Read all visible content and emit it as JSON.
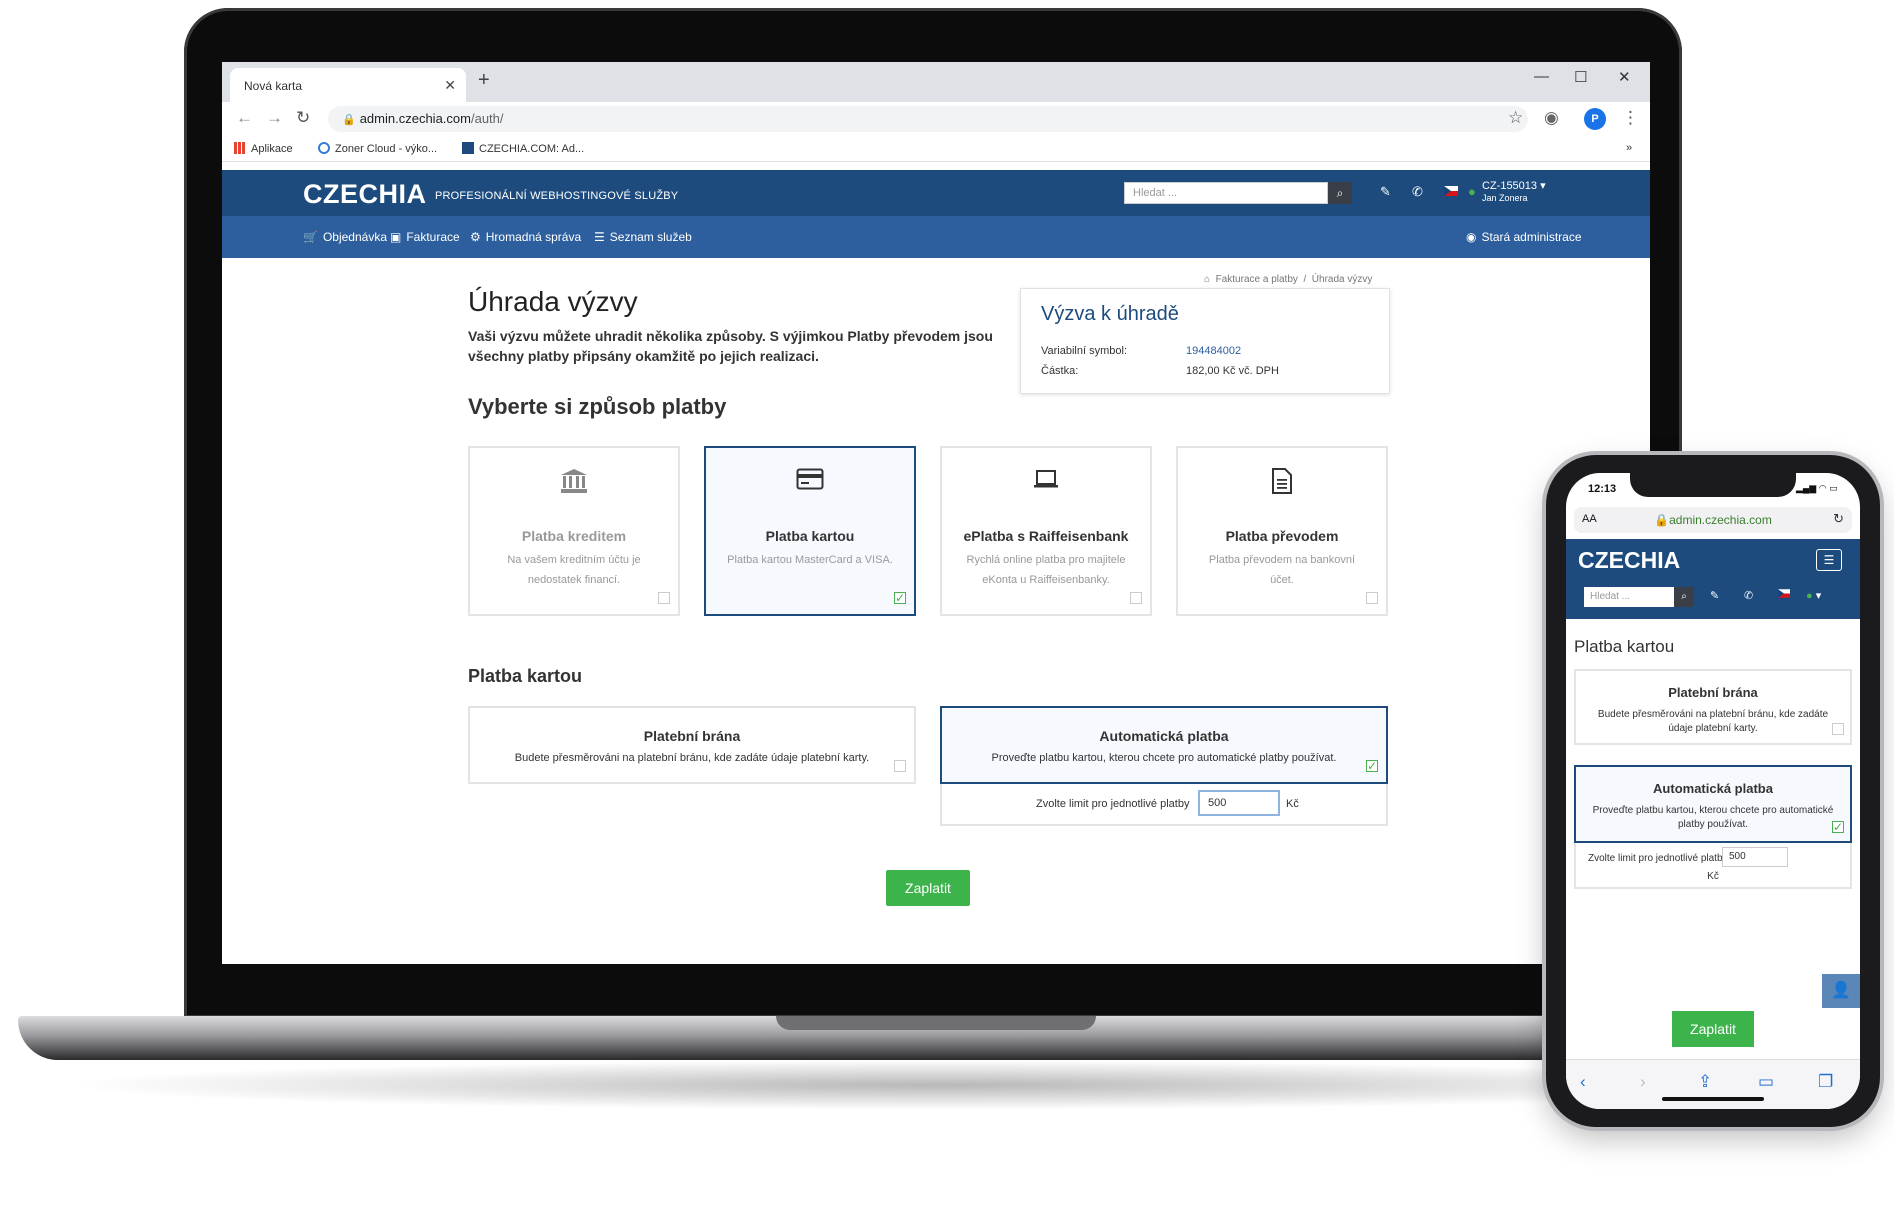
{
  "browser": {
    "tab_title": "Nová karta",
    "url_host": "admin.czechia.com",
    "url_path": "/auth/",
    "profile_initial": "P",
    "bookmarks": [
      "Aplikace",
      "Zoner Cloud - výko...",
      "CZECHIA.COM: Ad..."
    ]
  },
  "site": {
    "logo": "CZECHIA",
    "tagline": "PROFESIONÁLNÍ WEBHOSTINGOVÉ SLUŽBY",
    "search_placeholder": "Hledat ...",
    "account_id": "CZ-155013",
    "account_name": "Jan Zonera",
    "nav": [
      "Objednávka",
      "Fakturace",
      "Hromadná správa",
      "Seznam služeb"
    ],
    "old_admin": "Stará administrace"
  },
  "page": {
    "breadcrumb_1": "Fakturace a platby",
    "breadcrumb_sep": "/",
    "breadcrumb_2": "Úhrada výzvy",
    "title": "Úhrada výzvy",
    "intro": "Vaši výzvu můžete uhradit několika způsoby. S výjimkou Platby převodem jsou všechny platby připsány okamžitě po jejich realizaci.",
    "summary": {
      "title": "Výzva k úhradě",
      "vs_label": "Variabilní symbol:",
      "vs_value": "194484002",
      "amount_label": "Částka:",
      "amount_value": "182,00 Kč vč. DPH"
    },
    "choose_method": "Vyberte si způsob platby",
    "methods": [
      {
        "title": "Platba kreditem",
        "desc": "Na vašem kreditním účtu je nedostatek financí.",
        "selected": false,
        "icon": "bank-icon"
      },
      {
        "title": "Platba kartou",
        "desc": "Platba kartou MasterCard a VISA.",
        "selected": true,
        "icon": "credit-card-icon"
      },
      {
        "title": "ePlatba s Raiffeisenbank",
        "desc": "Rychlá online platba pro majitele eKonta u Raiffeisenbanky.",
        "selected": false,
        "icon": "laptop-icon"
      },
      {
        "title": "Platba převodem",
        "desc": "Platba převodem na bankovní účet.",
        "selected": false,
        "icon": "document-icon"
      }
    ],
    "card_section": "Platba kartou",
    "card_options": [
      {
        "title": "Platební brána",
        "desc": "Budete přesměrováni na platební bránu, kde zadáte údaje platební karty.",
        "selected": false
      },
      {
        "title": "Automatická platba",
        "desc": "Proveďte platbu kartou, kterou chcete pro automatické platby používat.",
        "selected": true
      }
    ],
    "limit_label": "Zvolte limit pro jednotlivé platby",
    "limit_value": "500",
    "limit_unit": "Kč",
    "pay_button": "Zaplatit"
  },
  "phone": {
    "time": "12:13",
    "aa": "AA",
    "url": "admin.czechia.com",
    "logo": "CZECHIA",
    "search_placeholder": "Hledat ...",
    "section": "Platba kartou",
    "gateway_title": "Platební brána",
    "gateway_desc": "Budete přesměrováni na platební bránu, kde zadáte údaje platební karty.",
    "auto_title": "Automatická platba",
    "auto_desc": "Proveďte platbu kartou, kterou chcete pro automatické platby používat.",
    "limit_label": "Zvolte limit pro jednotlivé platby",
    "limit_value": "500",
    "limit_unit": "Kč",
    "pay_button": "Zaplatit"
  }
}
